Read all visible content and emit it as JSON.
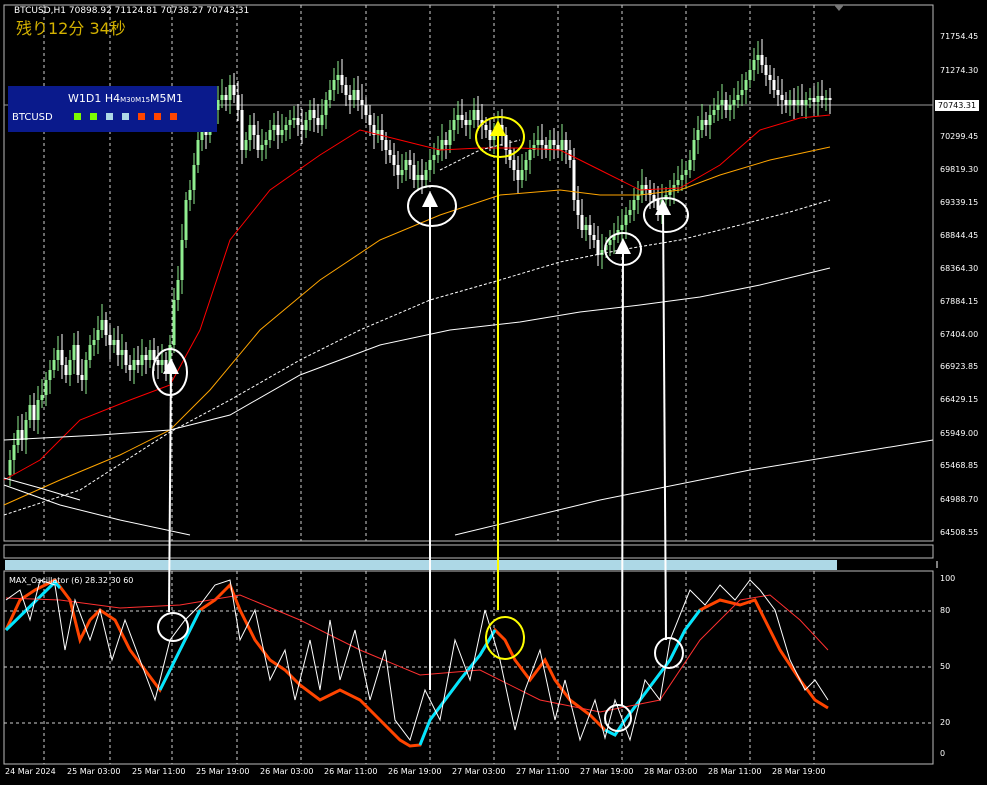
{
  "header": {
    "symbol_line": "BTCUSD,H1  70898.92 71124.81 70738.27 70743.31",
    "countdown": "残り12分 34秒"
  },
  "mtf_panel": {
    "timeframes": [
      "W1",
      "D1",
      "H4",
      "M30",
      "M15",
      "M5",
      "M1"
    ],
    "symbol": "BTCUSD",
    "square_colors": [
      "#7cfc00",
      "#7cfc00",
      "#add8e6",
      "#add8e6",
      "#ff4500",
      "#ff4500",
      "#ff4500"
    ]
  },
  "price_axis": {
    "labels": [
      "71754.45",
      "71274.30",
      "70299.45",
      "69819.30",
      "69339.15",
      "68844.45",
      "68364.30",
      "67884.15",
      "67404.00",
      "66923.85",
      "66429.15",
      "65949.00",
      "65468.85",
      "64988.70",
      "64508.55"
    ],
    "current_price": "70743.31"
  },
  "oscillator": {
    "title": "MAX_Oscillator (6) 28.32 30 60",
    "levels": [
      "100",
      "80",
      "50",
      "20",
      "0"
    ]
  },
  "strip_label": "",
  "time_axis": {
    "labels": [
      "24 Mar 2024",
      "25 Mar 03:00",
      "25 Mar 11:00",
      "25 Mar 19:00",
      "26 Mar 03:00",
      "26 Mar 11:00",
      "26 Mar 19:00",
      "27 Mar 03:00",
      "27 Mar 11:00",
      "27 Mar 19:00",
      "28 Mar 03:00",
      "28 Mar 11:00",
      "28 Mar 19:00"
    ]
  },
  "colors": {
    "candle_up": "#90ee90",
    "candle_down": "#ffffff",
    "ma_fast": "#ff0000",
    "ma_mid": "#ffa500",
    "ma_slow": "#ffffff",
    "osc_up": "#00e5ff",
    "osc_down": "#ff4500",
    "highlight": "#ffff00"
  }
}
